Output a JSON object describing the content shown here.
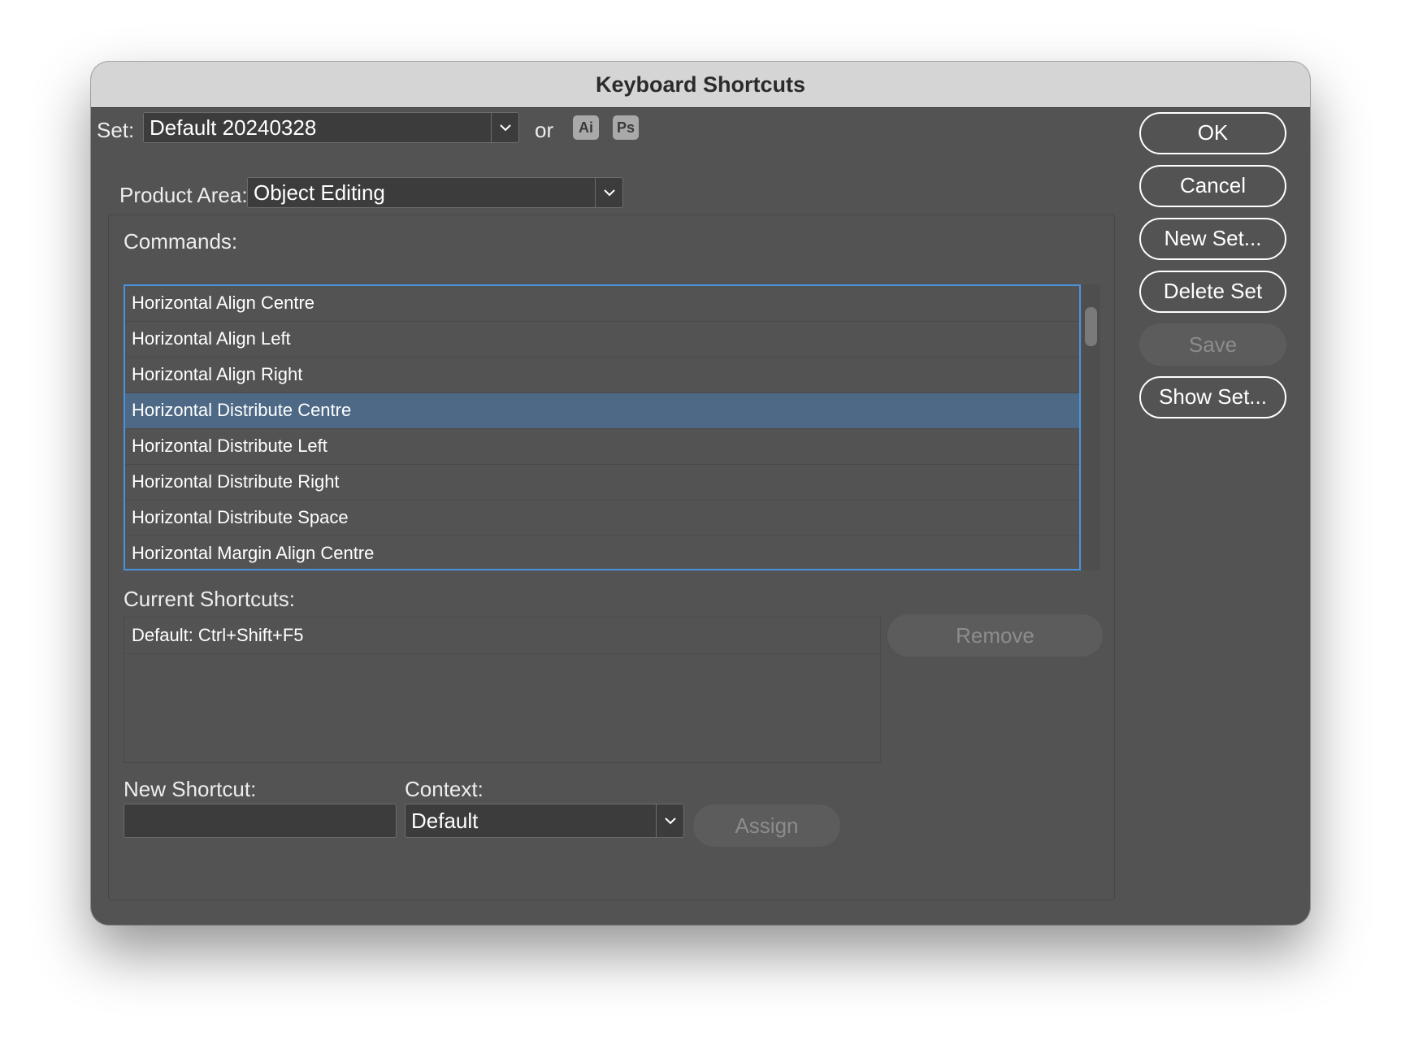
{
  "dialog": {
    "title": "Keyboard Shortcuts"
  },
  "set": {
    "label": "Set:",
    "value": "Default 20240328",
    "or_label": "or",
    "app_badges": [
      "Ai",
      "Ps"
    ]
  },
  "product_area": {
    "label": "Product Area:",
    "value": "Object Editing"
  },
  "commands": {
    "label": "Commands:",
    "items": [
      "Horizontal Align Centre",
      "Horizontal Align Left",
      "Horizontal Align Right",
      "Horizontal Distribute Centre",
      "Horizontal Distribute Left",
      "Horizontal Distribute Right",
      "Horizontal Distribute Space",
      "Horizontal Margin Align Centre"
    ],
    "selected_item": "Horizontal Distribute Centre"
  },
  "current_shortcuts": {
    "label": "Current Shortcuts:",
    "items": [
      "Default: Ctrl+Shift+F5"
    ],
    "remove_label": "Remove"
  },
  "new_shortcut": {
    "label": "New Shortcut:",
    "value": "",
    "placeholder": ""
  },
  "context": {
    "label": "Context:",
    "value": "Default"
  },
  "assign_label": "Assign",
  "buttons": {
    "ok": "OK",
    "cancel": "Cancel",
    "new_set": "New Set...",
    "delete_set": "Delete Set",
    "save": "Save",
    "show_set": "Show Set..."
  },
  "colors": {
    "dialog_background": "#535353",
    "titlebar": "#d5d5d5",
    "selection": "#4d6986",
    "focus_ring": "#4a93e0",
    "disabled_text": "#8c8c8c"
  }
}
